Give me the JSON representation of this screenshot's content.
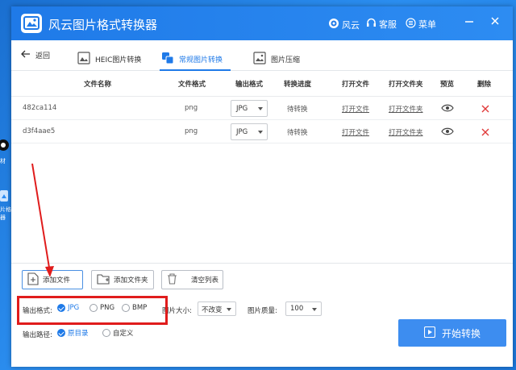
{
  "app": {
    "title": "风云图片格式转换器"
  },
  "titlebar": {
    "brand": "风云",
    "service": "客服",
    "menu": "菜单"
  },
  "nav": {
    "back": "返回",
    "tabs": [
      {
        "label": "HEIC图片转换",
        "active": false
      },
      {
        "label": "常规图片转换",
        "active": true
      },
      {
        "label": "图片压缩",
        "active": false
      }
    ]
  },
  "table": {
    "headers": [
      "文件名称",
      "文件格式",
      "输出格式",
      "转换进度",
      "打开文件",
      "打开文件夹",
      "预览",
      "删除"
    ],
    "rows": [
      {
        "name": "482ca114",
        "format": "png",
        "output": "JPG",
        "status": "待转换",
        "open_file": "打开文件",
        "open_folder": "打开文件夹"
      },
      {
        "name": "d3f4aae5",
        "format": "png",
        "output": "JPG",
        "status": "待转换",
        "open_file": "打开文件",
        "open_folder": "打开文件夹"
      }
    ]
  },
  "actions": {
    "add_file": "添加文件",
    "add_folder": "添加文件夹",
    "clear_list": "清空列表"
  },
  "settings": {
    "format_label": "输出格式:",
    "formats": [
      {
        "label": "JPG",
        "selected": true
      },
      {
        "label": "PNG",
        "selected": false
      },
      {
        "label": "BMP",
        "selected": false
      }
    ],
    "size_label": "图片大小:",
    "size_value": "不改变",
    "quality_label": "图片质量:",
    "quality_value": "100",
    "path_label": "输出路径:",
    "paths": [
      {
        "label": "原目录",
        "selected": true
      },
      {
        "label": "自定义",
        "selected": false
      }
    ]
  },
  "start_button": "开始转换",
  "desktop": {
    "labels": [
      "材",
      "片格式",
      "器"
    ]
  },
  "colors": {
    "accent": "#1f7ae8",
    "highlight": "#e01c1c",
    "start": "#3d8df0"
  }
}
